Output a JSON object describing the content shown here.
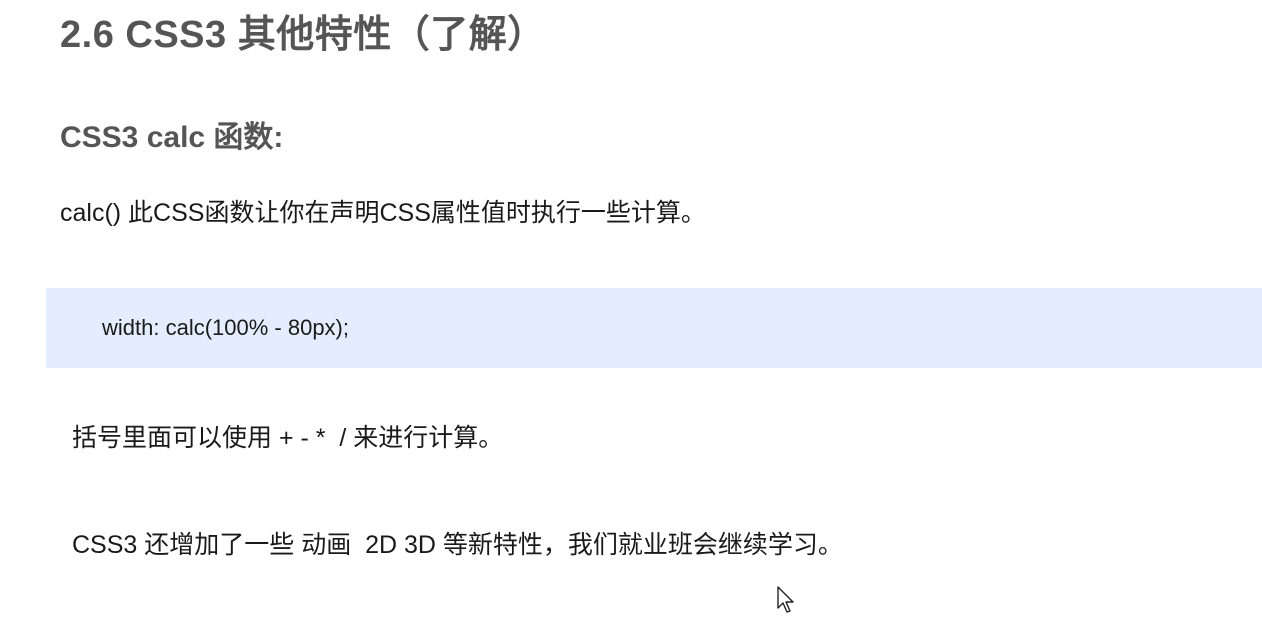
{
  "section": {
    "title": "2.6 CSS3 其他特性（了解）"
  },
  "calc": {
    "heading": "CSS3 calc 函数:",
    "description": "calc() 此CSS函数让你在声明CSS属性值时执行一些计算。",
    "code_example": "width: calc(100% - 80px);",
    "operators_note": "括号里面可以使用 + - *  / 来进行计算。"
  },
  "more": {
    "note": "CSS3 还增加了一些 动画  2D 3D 等新特性，我们就业班会继续学习。"
  },
  "cursor": {
    "icon": "mouse-pointer-icon"
  }
}
